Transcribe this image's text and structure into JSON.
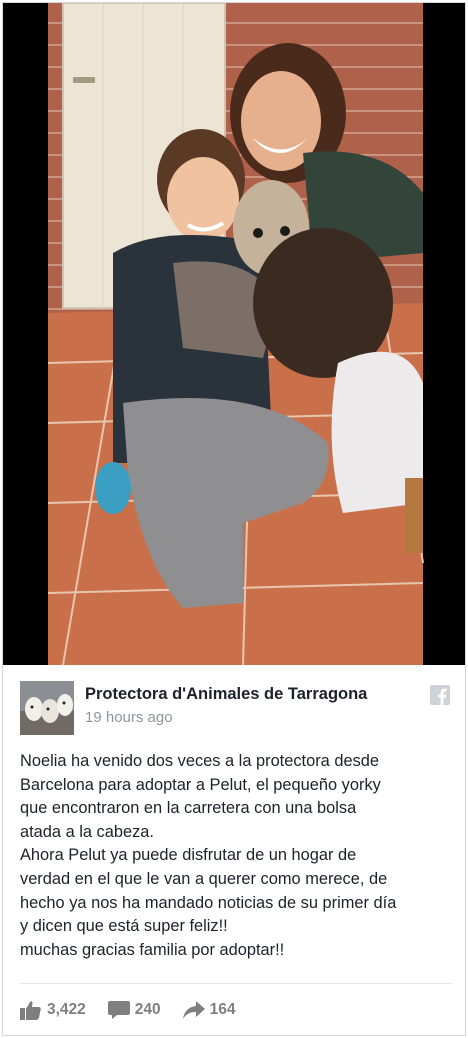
{
  "post": {
    "page_name": "Protectora d'Animales de Tarragona",
    "timestamp": "19 hours ago",
    "text_lines": [
      "Noelia ha venido dos veces a la protectora desde",
      "Barcelona para adoptar a Pelut, el pequeño yorky",
      "que encontraron en la carretera con una bolsa",
      "atada a la cabeza.",
      "Ahora Pelut ya puede disfrutar de un hogar de",
      "verdad en el que le van a querer como merece, de",
      "hecho ya nos ha mandado noticias de su primer día",
      "y dicen que está super feliz!!",
      "muchas gracias familia por adoptar!!"
    ]
  },
  "stats": {
    "likes": "3,422",
    "comments": "240",
    "shares": "164"
  },
  "icons": {
    "brand": "facebook-icon",
    "like": "thumbs-up-icon",
    "comment": "comment-icon",
    "share": "share-arrow-icon"
  },
  "colors": {
    "text": "#1d2129",
    "meta": "#90949c",
    "stats": "#7f7f7f"
  }
}
